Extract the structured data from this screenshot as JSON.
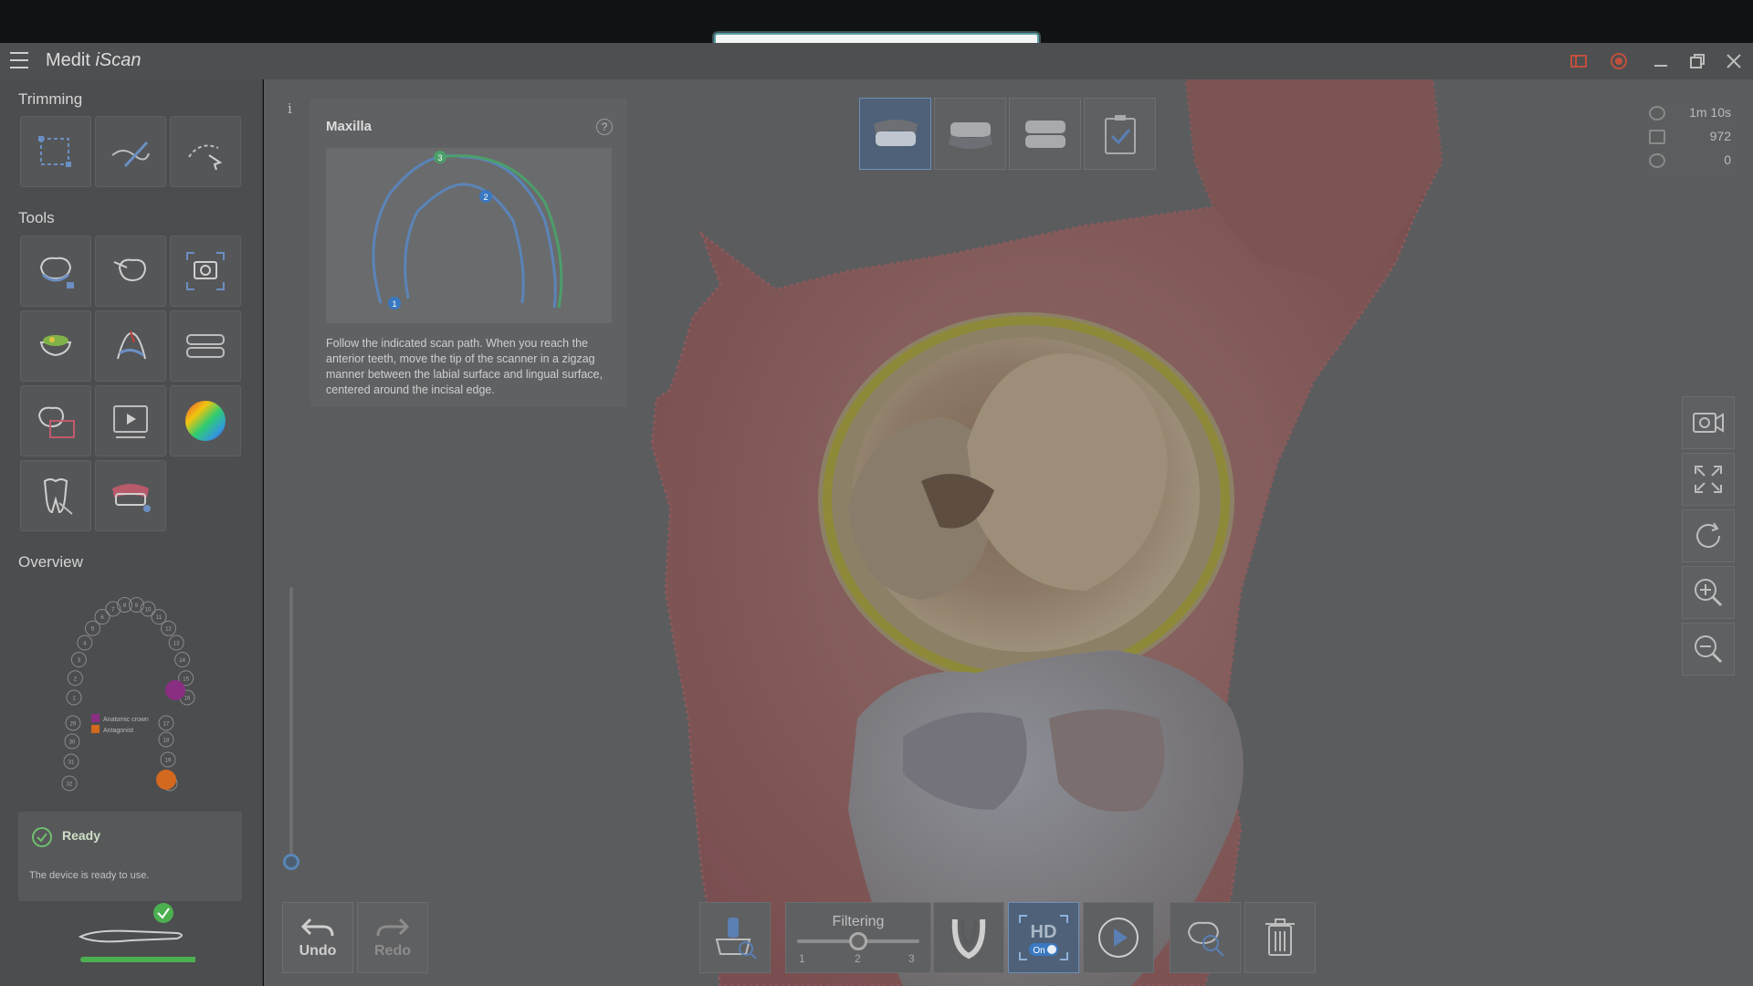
{
  "app": {
    "title_prefix": "Medit ",
    "title_brand": "iScan"
  },
  "sidebar": {
    "trimming_label": "Trimming",
    "tools_label": "Tools",
    "overview_label": "Overview",
    "trimming_tools": [
      "box-select-trim-icon",
      "brush-trim-icon",
      "lasso-trim-icon"
    ],
    "tools": [
      "tooth-lock-icon",
      "tooth-abutment-icon",
      "capture-snapshot-icon",
      "occlusion-color-icon",
      "margin-line-icon",
      "jaw-alignment-icon",
      "scan-compare-icon",
      "play-video-icon",
      "color-sphere-icon",
      "tooth-pencil-icon",
      "denture-scan-icon"
    ],
    "overview_legend": [
      "Anatomic crown",
      "Antagonist"
    ],
    "tooth_numbers": [
      "1",
      "2",
      "3",
      "4",
      "5",
      "6",
      "7",
      "8",
      "9",
      "10",
      "11",
      "12",
      "13",
      "14",
      "15",
      "16",
      "17",
      "18",
      "19",
      "20",
      "21",
      "22",
      "23",
      "24",
      "25",
      "26",
      "27",
      "28",
      "29",
      "30",
      "31",
      "32"
    ],
    "status": {
      "title": "Ready",
      "description": "The device is ready to use."
    }
  },
  "guide": {
    "title": "Maxilla",
    "help": "?",
    "steps": [
      "1",
      "2",
      "3"
    ],
    "text": "Follow the indicated scan path. When you reach the anterior teeth, move the tip of the scanner in a zigzag manner between the labial surface and lingual surface, centered around the incisal edge."
  },
  "info": "i",
  "jaw_tabs": [
    "maxilla-icon",
    "mandible-icon",
    "occlusion-icon",
    "checklist-icon"
  ],
  "stats": {
    "time": "1m 10s",
    "frames": "972",
    "count": "0"
  },
  "right_tools": [
    "video-record-icon",
    "fit-screen-icon",
    "reset-view-icon",
    "zoom-in-icon",
    "zoom-out-icon"
  ],
  "bottom": {
    "undo": "Undo",
    "redo": "Redo",
    "filtering": {
      "label": "Filtering",
      "ticks": [
        "1",
        "2",
        "3"
      ],
      "value": 2
    },
    "hd_label": "HD",
    "hd_state": "On"
  },
  "colors": {
    "accent_blue": "#4e6178",
    "ready_green": "#4caf50",
    "crown_purple": "#8a2e82",
    "antagonist_orange": "#d2691e"
  }
}
